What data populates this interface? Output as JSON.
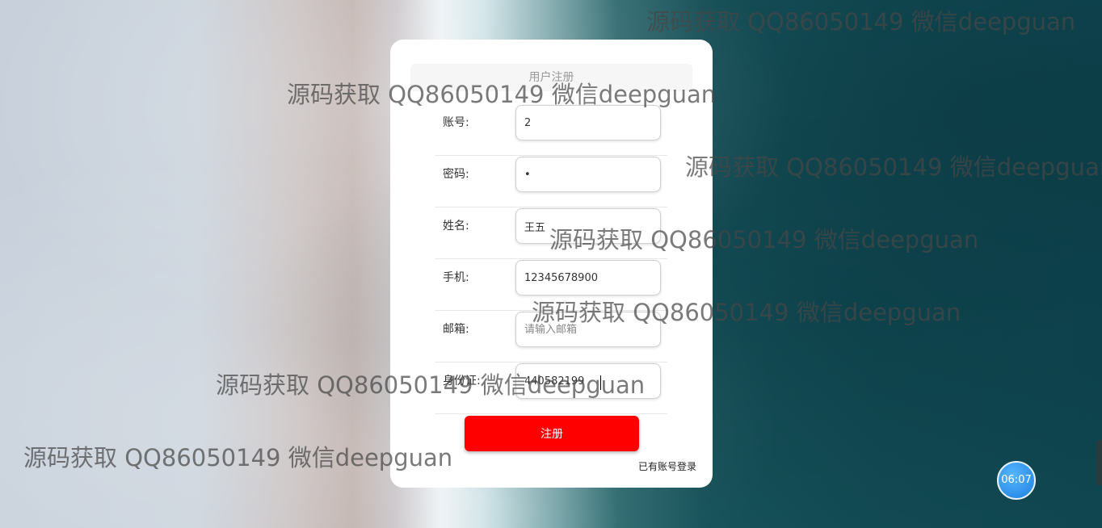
{
  "form": {
    "title": "用户注册",
    "fields": [
      {
        "label": "账号:",
        "value": "2",
        "placeholder": ""
      },
      {
        "label": "密码:",
        "value": "•",
        "placeholder": ""
      },
      {
        "label": "姓名:",
        "value": "王五",
        "placeholder": ""
      },
      {
        "label": "手机:",
        "value": "12345678900",
        "placeholder": ""
      },
      {
        "label": "邮箱:",
        "value": "",
        "placeholder": "请输入邮箱"
      },
      {
        "label": "身份证:",
        "value": "440582199",
        "placeholder": ""
      }
    ],
    "submit_label": "注册",
    "login_link": "已有账号登录"
  },
  "watermark_text": "源码获取 QQ86050149 微信deepguan",
  "clock": {
    "time": "06:07"
  }
}
